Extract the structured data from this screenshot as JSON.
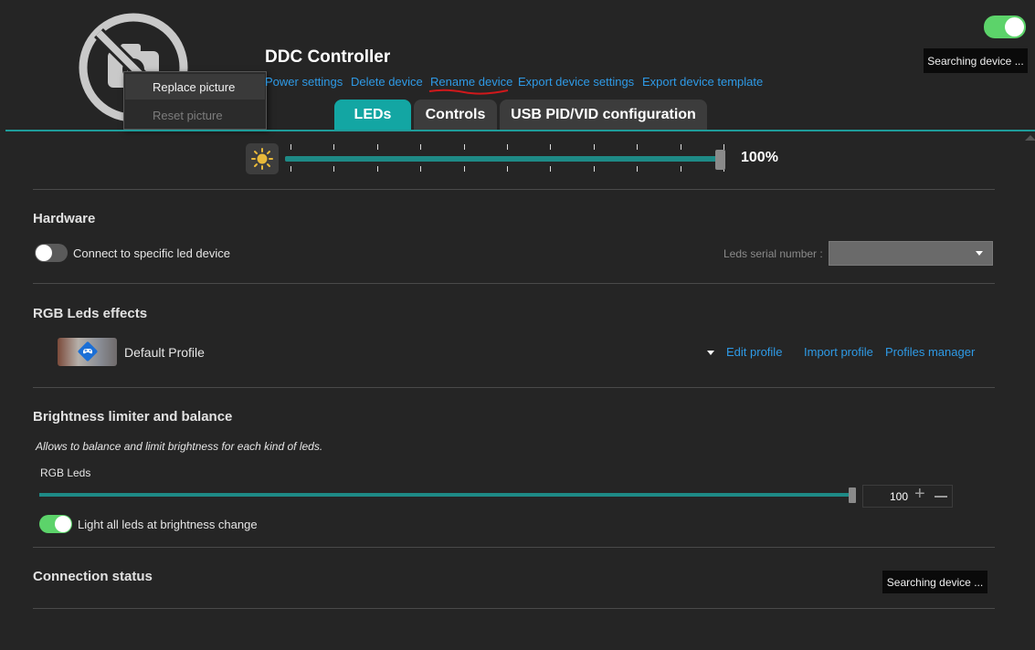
{
  "header": {
    "device_name": "DDC Controller",
    "links": [
      {
        "label": "Power settings"
      },
      {
        "label": "Delete device"
      },
      {
        "label": "Rename device"
      },
      {
        "label": "Export device settings"
      },
      {
        "label": "Export device template"
      }
    ],
    "status_badge": "Searching device ...",
    "master_toggle_on": true
  },
  "context_menu": {
    "items": [
      {
        "label": "Replace picture",
        "enabled": true
      },
      {
        "label": "Reset picture",
        "enabled": false
      }
    ]
  },
  "tabs": [
    {
      "label": "LEDs",
      "active": true
    },
    {
      "label": "Controls",
      "active": false
    },
    {
      "label": "USB PID/VID configuration",
      "active": false
    }
  ],
  "brightness": {
    "value_label": "100%",
    "value_fraction": 1.0,
    "icon": "sun-icon"
  },
  "hardware": {
    "title": "Hardware",
    "toggle_label": "Connect to specific led device",
    "toggle_on": false,
    "serial_label": "Leds serial number :",
    "serial_value": ""
  },
  "rgb_effects": {
    "title": "RGB Leds effects",
    "profile_name": "Default Profile",
    "edit_profile": "Edit profile",
    "import_profile": "Import profile",
    "profiles_manager": "Profiles manager"
  },
  "limiter": {
    "title": "Brightness limiter and balance",
    "description": "Allows to balance and limit brightness for each kind of leds.",
    "rgb_label": "RGB Leds",
    "rgb_value": "100",
    "rgb_fraction": 1.0,
    "light_all_label": "Light all leds at brightness change",
    "light_all_on": true
  },
  "connection": {
    "title": "Connection status",
    "status": "Searching device ..."
  },
  "colors": {
    "accent": "#1e9c9a",
    "toggle_on": "#5cd36a",
    "link": "#2e9ae6",
    "background": "#252525"
  }
}
